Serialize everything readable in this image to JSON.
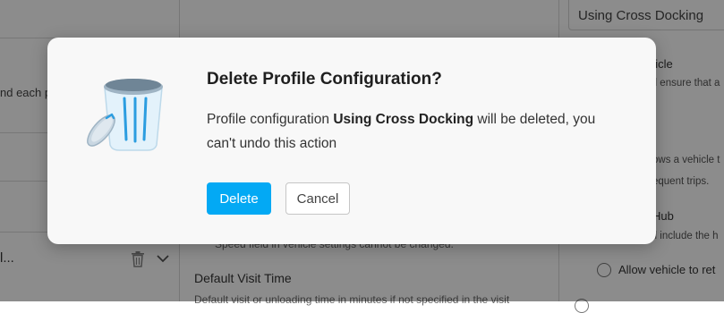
{
  "background": {
    "left_panel": {
      "partial_text": "nd each p",
      "row_label": "l...",
      "trash_icon": "trash-icon",
      "chevron_icon": "chevron-down-icon"
    },
    "center_panel": {
      "speed_note": "Speed field in vehicle settings cannot be changed.",
      "default_visit_time_label": "Default Visit Time",
      "default_visit_time_desc": "Default visit or unloading time in minutes if not specified in the visit"
    },
    "right_panel": {
      "profile_select_value": "Using Cross Docking",
      "vehicle_heading_partial": "nicle",
      "vehicle_desc_partial": "ll ensure that a",
      "allows_partial": "ows a vehicle t",
      "frequent_partial": "equent trips.",
      "hub_heading_partial": "Hub",
      "hub_desc_partial": "ll include the h",
      "allow_vehicle_label": "Allow vehicle to ret"
    }
  },
  "dialog": {
    "icon": "trash-bin-icon",
    "title": "Delete Profile Configuration?",
    "body_prefix": "Profile configuration ",
    "profile_name": "Using Cross Docking",
    "body_suffix": " will be deleted, you can't undo this action",
    "delete_label": "Delete",
    "cancel_label": "Cancel"
  },
  "colors": {
    "primary": "#03a9f4",
    "overlay": "rgba(0,0,0,0.45)",
    "dialog_bg": "#f8f8f8"
  }
}
